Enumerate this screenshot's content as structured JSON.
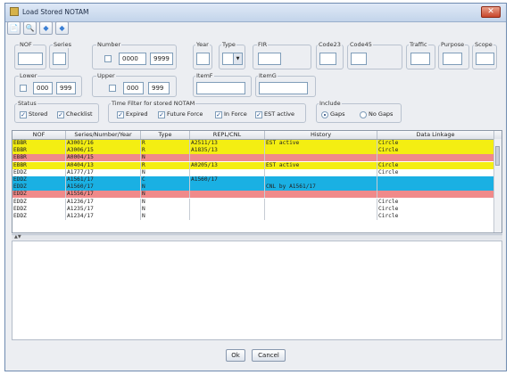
{
  "window": {
    "title": "Load Stored NOTAM",
    "close_glyph": "✕"
  },
  "toolbar": [
    {
      "name": "open-icon",
      "glyph": "📄"
    },
    {
      "name": "search-icon",
      "glyph": "🔍"
    },
    {
      "name": "previous-icon",
      "glyph": "◆"
    },
    {
      "name": "next-icon",
      "glyph": "◆"
    }
  ],
  "filters": {
    "nof": {
      "label": "NOF",
      "value": ""
    },
    "series": {
      "label": "Series",
      "value": ""
    },
    "number": {
      "label": "Number",
      "from": "0000",
      "to": "9999"
    },
    "year": {
      "label": "Year",
      "value": ""
    },
    "type": {
      "label": "Type",
      "value": "",
      "arrow": "▼"
    },
    "fir": {
      "label": "FIR",
      "value": ""
    },
    "code23": {
      "label": "Code23",
      "value": ""
    },
    "code45": {
      "label": "Code45",
      "value": ""
    },
    "traffic": {
      "label": "Traffic",
      "value": ""
    },
    "purpose": {
      "label": "Purpose",
      "value": ""
    },
    "scope": {
      "label": "Scope",
      "value": ""
    },
    "lower": {
      "label": "Lower",
      "from": "000",
      "to": "999"
    },
    "upper": {
      "label": "Upper",
      "from": "000",
      "to": "999"
    },
    "itemf": {
      "label": "ItemF",
      "value": ""
    },
    "itemg": {
      "label": "ItemG",
      "value": ""
    }
  },
  "status": {
    "label": "Status",
    "stored": {
      "label": "Stored",
      "checked": true
    },
    "checklist": {
      "label": "Checklist",
      "checked": true
    }
  },
  "time_filter": {
    "label": "Time Filter for stored NOTAM",
    "expired": {
      "label": "Expired",
      "checked": true
    },
    "future_force": {
      "label": "Future Force",
      "checked": true
    },
    "in_force": {
      "label": "In Force",
      "checked": true
    },
    "est_active": {
      "label": "EST active",
      "checked": true
    }
  },
  "include": {
    "label": "Include",
    "gaps": {
      "label": "Gaps",
      "selected": true
    },
    "no_gaps": {
      "label": "No Gaps",
      "selected": false
    }
  },
  "table": {
    "columns": [
      "NOF",
      "Series/Number/Year",
      "Type",
      "REPL/CNL",
      "History",
      "Data Linkage"
    ],
    "rows": [
      {
        "cells": [
          "EBBR",
          "A3001/16",
          "R",
          "A2511/13",
          "EST active",
          "Circle"
        ],
        "color": "#f4ee12"
      },
      {
        "cells": [
          "EBBR",
          "A3006/15",
          "R",
          "A1835/13",
          "",
          "Circle"
        ],
        "color": "#f4ee12"
      },
      {
        "cells": [
          "EBBR",
          "A0004/15",
          "N",
          "",
          "",
          ""
        ],
        "color": "#f08a8a"
      },
      {
        "cells": [
          "EBBR",
          "A0404/13",
          "R",
          "A0205/13",
          "EST active",
          "Circle"
        ],
        "color": "#f4ee12"
      },
      {
        "cells": [
          "EDDZ",
          "A1777/17",
          "N",
          "",
          "",
          "Circle"
        ],
        "color": "#ffffff"
      },
      {
        "cells": [
          "EDDZ",
          "A1561/17",
          "C",
          "A1560/17",
          "",
          ""
        ],
        "color": "#1ab0e3"
      },
      {
        "cells": [
          "EDDZ",
          "A1560/17",
          "N",
          "",
          "CNL by A1561/17",
          ""
        ],
        "color": "#1ab0e3"
      },
      {
        "cells": [
          "EDDZ",
          "A1556/17",
          "N",
          "",
          "",
          ""
        ],
        "color": "#f08a8a"
      },
      {
        "cells": [
          "EDDZ",
          "A1236/17",
          "N",
          "",
          "",
          "Circle"
        ],
        "color": "#ffffff"
      },
      {
        "cells": [
          "EDDZ",
          "A1235/17",
          "N",
          "",
          "",
          "Circle"
        ],
        "color": "#ffffff"
      },
      {
        "cells": [
          "EDDZ",
          "A1234/17",
          "N",
          "",
          "",
          "Circle"
        ],
        "color": "#ffffff"
      }
    ]
  },
  "splitter": {
    "glyph": "▲▼"
  },
  "buttons": {
    "ok": "Ok",
    "cancel": "Cancel"
  }
}
